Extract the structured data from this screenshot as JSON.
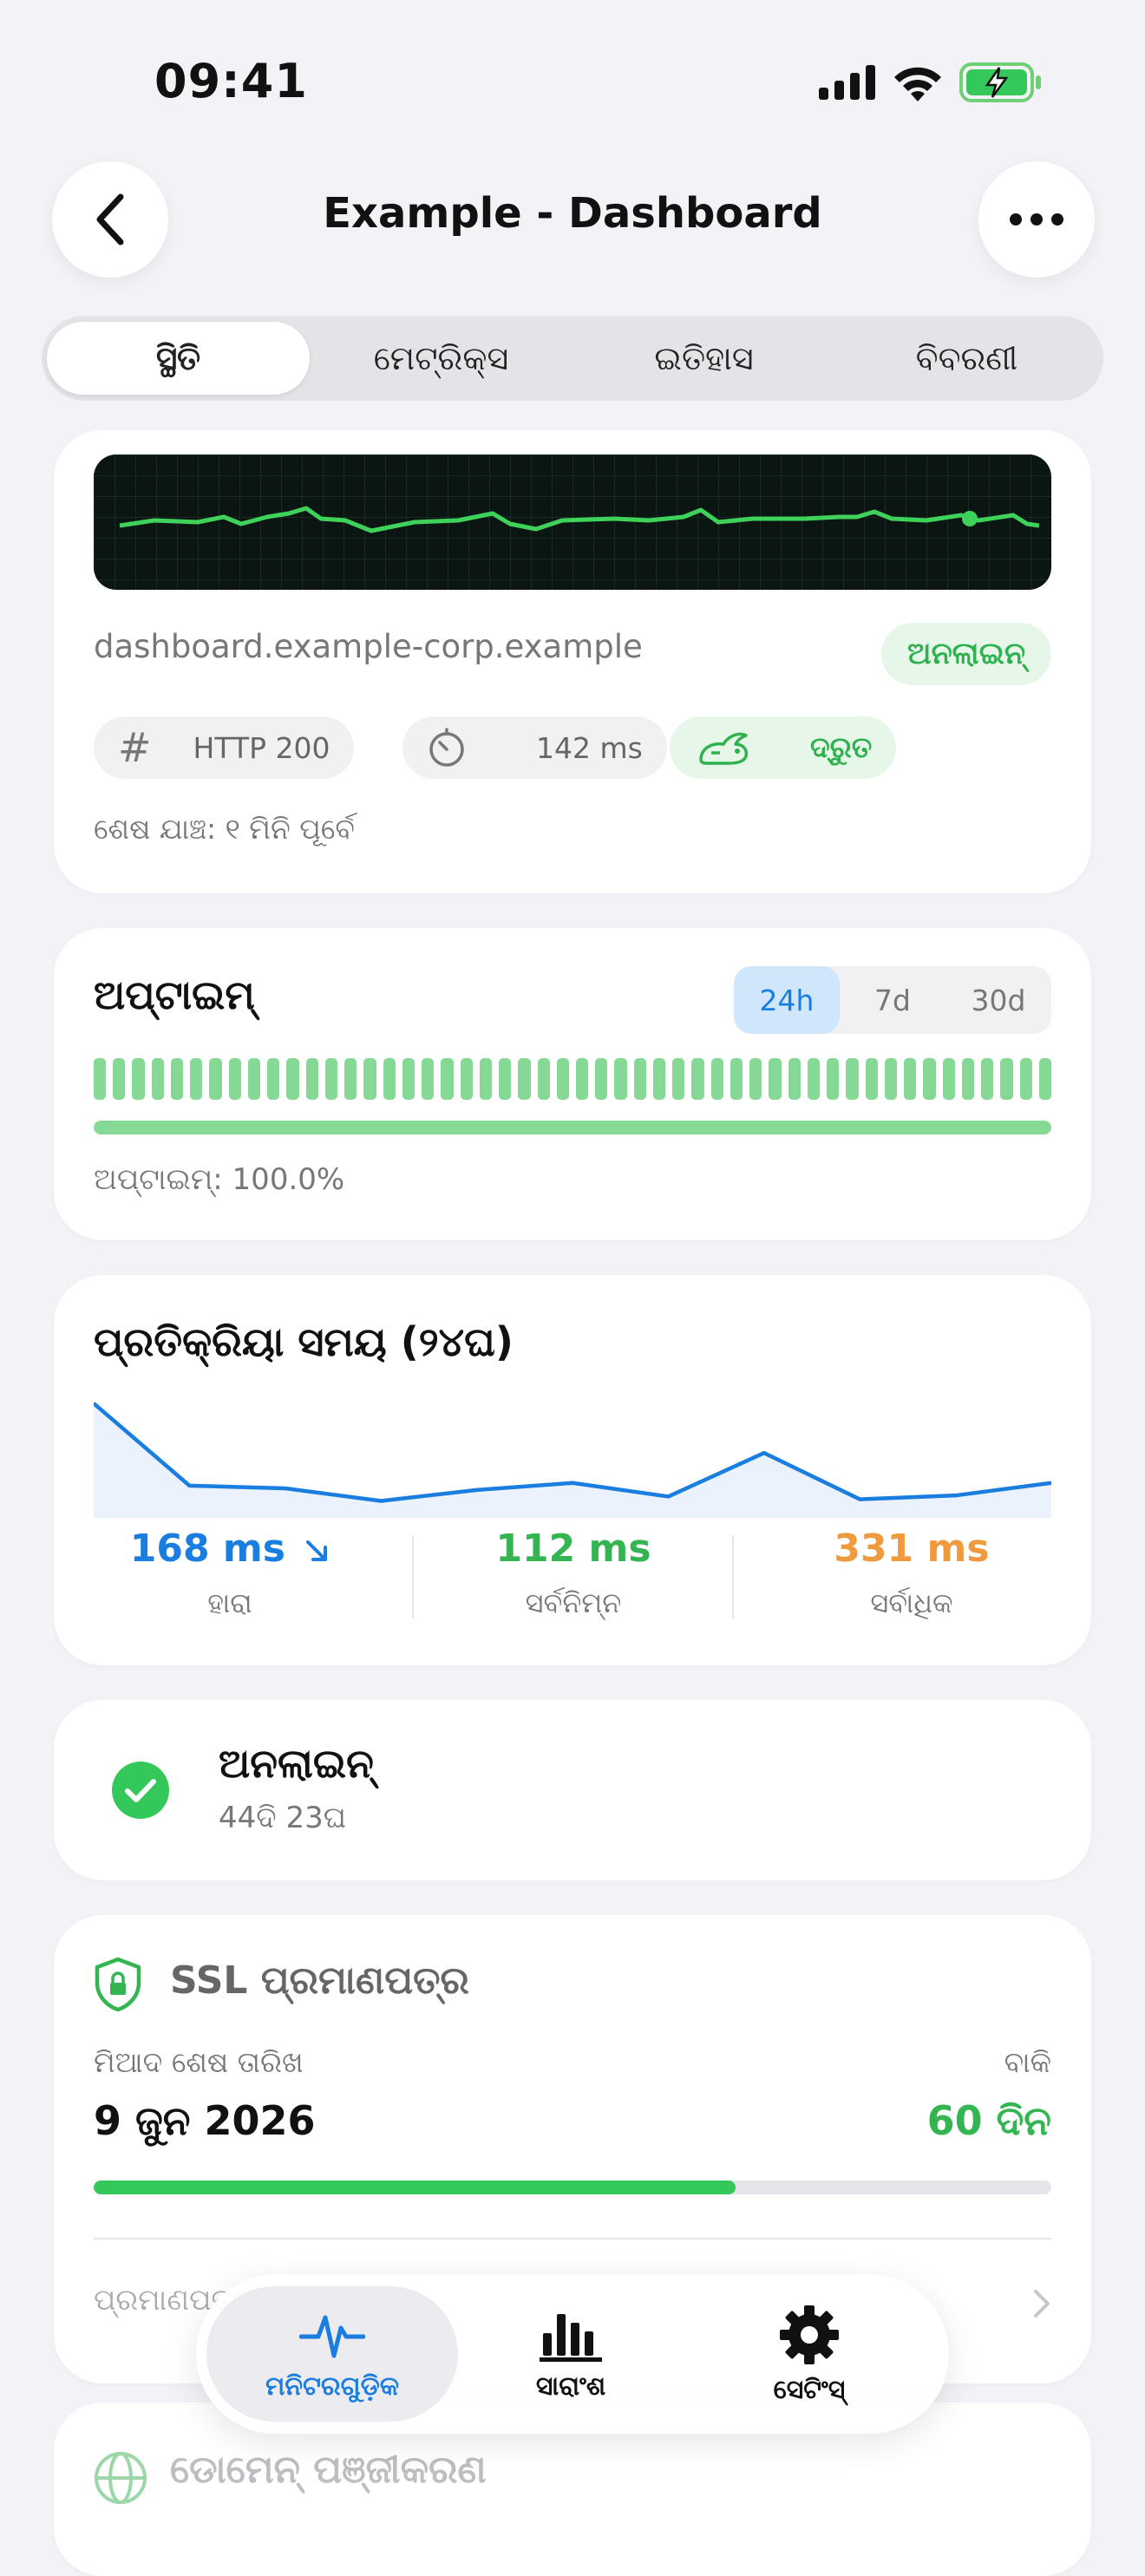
{
  "status_bar": {
    "time": "09:41"
  },
  "nav": {
    "title": "Example - Dashboard"
  },
  "segments": [
    {
      "label": "ସ୍ଥିତି",
      "active": true
    },
    {
      "label": "ମେଟ୍ରିକ୍ସ",
      "active": false
    },
    {
      "label": "ଇତିହାସ",
      "active": false
    },
    {
      "label": "ବିବରଣୀ",
      "active": false
    }
  ],
  "status_card": {
    "host": "dashboard.example-corp.example",
    "state_badge": "ଅନଲାଇନ୍",
    "http_label": "HTTP 200",
    "latency_label": "142 ms",
    "speed_label": "ଦ୍ରୁତ",
    "last_check": "ଶେଷ ଯାଞ୍ଚ: ୧ ମିନି ପୂର୍ବେ"
  },
  "uptime_card": {
    "title": "ଅପ୍‌ଟାଇମ୍",
    "ranges": [
      "24h",
      "7d",
      "30d"
    ],
    "active_range": "24h",
    "summary": "ଅପ୍‌ଟାଇମ୍: 100.0%",
    "uptime_fraction": 1.0
  },
  "response_card": {
    "title": "ପ୍ରତିକ୍ରିୟା ସମୟ (୨୪ଘ)",
    "avg_value": "168 ms",
    "avg_label": "ହାରା",
    "min_value": "112 ms",
    "min_label": "ସର୍ବନିମ୍ନ",
    "max_value": "331 ms",
    "max_label": "ସର୍ବାଧିକ",
    "sparkline_ms": [
      331,
      180,
      175,
      152,
      172,
      185,
      160,
      240,
      155,
      162,
      185
    ]
  },
  "online_card": {
    "title": "ଅନଲାଇନ୍",
    "duration": "44ଦି 23ଘ"
  },
  "ssl_card": {
    "title": "SSL ପ୍ରମାଣପତ୍ର",
    "expiry_label": "ମିଆଦ ଶେଷ ତାରିଖ",
    "expiry_date": "9 ଜୁନ 2026",
    "remaining_label": "ବାକି",
    "remaining_value": "60 ଦିନ",
    "remaining_fraction": 0.67,
    "cert_row": "ପ୍ରମାଣପତ୍ର"
  },
  "domain_card": {
    "title": "ଡୋମେନ୍ ପଞ୍ଜୀକରଣ"
  },
  "tabbar": [
    {
      "label": "ମନିଟରଗୁଡ଼ିକ",
      "icon": "pulse-icon",
      "active": true
    },
    {
      "label": "ସାରାଂଶ",
      "icon": "bar-chart-icon",
      "active": false
    },
    {
      "label": "ସେଟିଂସ୍",
      "icon": "gear-icon",
      "active": false
    }
  ],
  "colors": {
    "accent": "#1a7de0",
    "green": "#34c759",
    "orange": "#f09a3e"
  }
}
